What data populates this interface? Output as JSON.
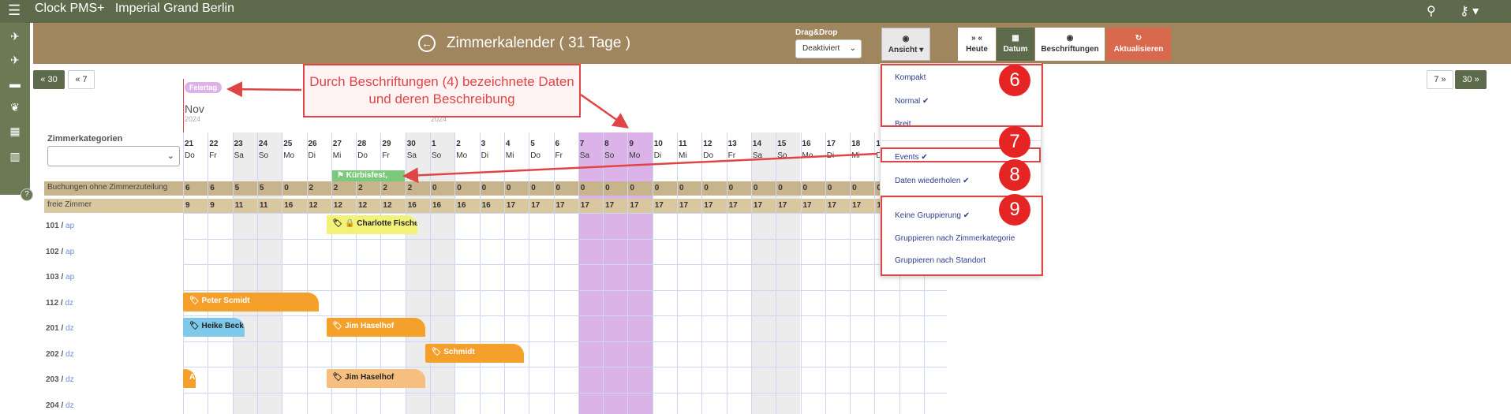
{
  "app": {
    "menu_icon": "menu-icon",
    "brand": "Clock PMS+",
    "hotel": "Imperial Grand Berlin"
  },
  "title": {
    "text": "Zimmerkalender ( 31 Tage )",
    "back_icon": "back-circle-icon"
  },
  "dragdrop": {
    "label": "Drag&Drop",
    "value": "Deaktiviert"
  },
  "toolbar": {
    "ansicht": "Ansicht",
    "heute": "Heute",
    "heute_icon": "» «",
    "datum": "Datum",
    "beschriftungen": "Beschriftungen",
    "aktualisieren": "Aktualisieren"
  },
  "nav": {
    "back30": "« 30",
    "back7": "« 7",
    "fwd7": "7 »",
    "fwd30": "30 »"
  },
  "calendar": {
    "holiday_tag": "Feiertag",
    "month": "Nov",
    "year": "2024",
    "year2": "2024",
    "category_label": "Zimmerkategorien",
    "days": [
      [
        "21",
        "Do"
      ],
      [
        "22",
        "Fr"
      ],
      [
        "23",
        "Sa"
      ],
      [
        "24",
        "So"
      ],
      [
        "25",
        "Mo"
      ],
      [
        "26",
        "Di"
      ],
      [
        "27",
        "Mi"
      ],
      [
        "28",
        "Do"
      ],
      [
        "29",
        "Fr"
      ],
      [
        "30",
        "Sa"
      ],
      [
        "1",
        "So"
      ],
      [
        "2",
        "Mo"
      ],
      [
        "3",
        "Di"
      ],
      [
        "4",
        "Mi"
      ],
      [
        "5",
        "Do"
      ],
      [
        "6",
        "Fr"
      ],
      [
        "7",
        "Sa"
      ],
      [
        "8",
        "So"
      ],
      [
        "9",
        "Mo"
      ],
      [
        "10",
        "Di"
      ],
      [
        "11",
        "Mi"
      ],
      [
        "12",
        "Do"
      ],
      [
        "13",
        "Fr"
      ],
      [
        "14",
        "Sa"
      ],
      [
        "15",
        "So"
      ],
      [
        "16",
        "Mo"
      ],
      [
        "17",
        "Di"
      ],
      [
        "18",
        "Mi"
      ],
      [
        "19",
        "Do"
      ]
    ],
    "event": "Kürbisfest,",
    "unassigned_label": "Buchungen ohne Zimmerzuteilung",
    "unassigned": [
      "6",
      "6",
      "5",
      "5",
      "0",
      "2",
      "2",
      "2",
      "2",
      "2",
      "0",
      "0",
      "0",
      "0",
      "0",
      "0",
      "0",
      "0",
      "0",
      "0",
      "0",
      "0",
      "0",
      "0",
      "0",
      "0",
      "0",
      "0",
      "0"
    ],
    "free_label": "freie Zimmer",
    "free": [
      "9",
      "9",
      "11",
      "11",
      "16",
      "12",
      "12",
      "12",
      "12",
      "16",
      "16",
      "16",
      "16",
      "17",
      "17",
      "17",
      "17",
      "17",
      "17",
      "17",
      "17",
      "17",
      "17",
      "17",
      "17",
      "17",
      "17",
      "17",
      "17"
    ],
    "rooms": [
      {
        "num": "101",
        "type": "ap"
      },
      {
        "num": "102",
        "type": "ap"
      },
      {
        "num": "103",
        "type": "ap"
      },
      {
        "num": "112",
        "type": "dz"
      },
      {
        "num": "201",
        "type": "dz"
      },
      {
        "num": "202",
        "type": "dz"
      },
      {
        "num": "203",
        "type": "dz"
      },
      {
        "num": "204",
        "type": "dz"
      }
    ],
    "bookings": [
      {
        "name": "Charlotte Fischer"
      },
      {
        "name": "Peter Scmidt"
      },
      {
        "name": "Heike Beck"
      },
      {
        "name": "Jim Haselhof"
      },
      {
        "name": "Schmidt"
      },
      {
        "name": "A"
      },
      {
        "name": "Jim Haselhof"
      }
    ]
  },
  "view_menu": {
    "items": [
      "Kompakt",
      "Normal ✔",
      "Breit",
      "Events ✔",
      "Daten wiederholen ✔",
      "Keine Gruppierung ✔",
      "Gruppieren nach Zimmerkategorie",
      "Gruppieren nach Standort"
    ]
  },
  "annotations": {
    "callout": "Durch Beschriftungen (4) bezeichnete Daten und deren Beschreibung",
    "n6": "6",
    "n7": "7",
    "n8": "8",
    "n9": "9"
  },
  "colors": {
    "topbar": "#5d6a4b",
    "subbar": "#a0865e",
    "booking_orange": "#f5a02a",
    "booking_blue": "#7ec8ea",
    "highlight": "#dcb3e8",
    "red": "#e04545"
  }
}
